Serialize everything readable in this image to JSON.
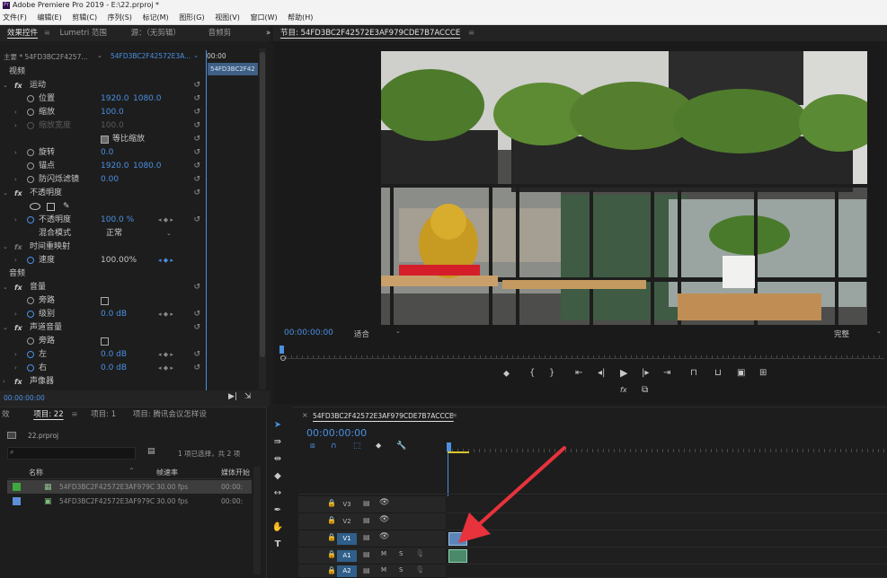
{
  "window": {
    "title": "Adobe Premiere Pro 2019 - E:\\22.prproj *",
    "logo": "Pr"
  },
  "menu": [
    "文件(F)",
    "编辑(E)",
    "剪辑(C)",
    "序列(S)",
    "标记(M)",
    "图形(G)",
    "视图(V)",
    "窗口(W)",
    "帮助(H)"
  ],
  "top_left_tabs": {
    "effect_controls": "效果控件",
    "lumetri": "Lumetri 范围",
    "source": "源：（无剪辑）",
    "audio": "音频剪",
    "more": "»"
  },
  "effect_controls": {
    "master": "主要 * 54FD3BC2F4257...",
    "clip": "54FD3BC2F42572E3A...",
    "ruler_time": "00:00",
    "clip_label": "54FD3BC2F42",
    "video_header": "视频",
    "motion": "运动",
    "position": {
      "label": "位置",
      "x": "1920.0",
      "y": "1080.0"
    },
    "scale": {
      "label": "缩放",
      "value": "100.0"
    },
    "scale_width": {
      "label": "缩放宽度",
      "value": "100.0"
    },
    "uniform_scale": "等比缩放",
    "rotation": {
      "label": "旋转",
      "value": "0.0"
    },
    "anchor": {
      "label": "锚点",
      "x": "1920.0",
      "y": "1080.0"
    },
    "anti_flicker": {
      "label": "防闪烁滤镜",
      "value": "0.00"
    },
    "opacity_header": "不透明度",
    "opacity": {
      "label": "不透明度",
      "value": "100.0 %"
    },
    "blend_mode": {
      "label": "混合模式",
      "value": "正常"
    },
    "time_remap": "时间重映射",
    "speed": {
      "label": "速度",
      "value": "100.00%"
    },
    "audio_header": "音频",
    "volume": "音量",
    "bypass": "旁路",
    "level": {
      "label": "级别",
      "value": "0.0 dB"
    },
    "channel_volume": "声道音量",
    "bypass2": "旁路",
    "left": {
      "label": "左",
      "value": "0.0 dB"
    },
    "right": {
      "label": "右",
      "value": "0.0 dB"
    },
    "panner": "声像器",
    "footer_time": "00:00:00:00"
  },
  "program": {
    "tab": "节目: 54FD3BC2F42572E3AF979CDE7B7ACCCE",
    "timecode": "00:00:00:00",
    "fit": "适合",
    "quality": "完整"
  },
  "project": {
    "tabs": {
      "effects": "效",
      "project": "项目: 22",
      "project1": "项目: 1",
      "project2": "项目: 腾讯会议怎样设"
    },
    "file": "22.prproj",
    "search_placeholder": "",
    "selection": "1 项已选择，共 2 项",
    "columns": {
      "name": "名称",
      "fps": "帧速率",
      "media": "媒体开始"
    },
    "items": [
      {
        "name": "54FD3BC2F42572E3AF979C",
        "fps": "30.00 fps",
        "start": "00:00:",
        "color": "#3fa83f"
      },
      {
        "name": "54FD3BC2F42572E3AF979C",
        "fps": "30.00 fps",
        "start": "00:00:",
        "color": "#5d8fd6"
      }
    ]
  },
  "timeline": {
    "tab": "54FD3BC2F42572E3AF979CDE7B7ACCCE",
    "timecode": "00:00:00:00",
    "tracks": [
      {
        "name": "V3",
        "selected": false,
        "kind": "video"
      },
      {
        "name": "V2",
        "selected": false,
        "kind": "video"
      },
      {
        "name": "V1",
        "selected": true,
        "kind": "video"
      },
      {
        "name": "A1",
        "selected": true,
        "kind": "audio"
      },
      {
        "name": "A2",
        "selected": true,
        "kind": "audio"
      }
    ],
    "track_m": "M",
    "track_s": "S"
  },
  "colors": {
    "accent": "#4a90e2",
    "annotation_arrow": "#e8323c"
  }
}
